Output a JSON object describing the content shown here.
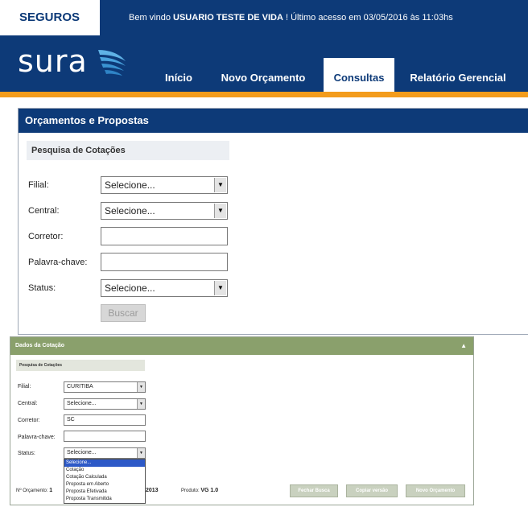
{
  "brand": {
    "seguros": "SEGUROS",
    "logo": "sura",
    "logo_icon": "sura-wings-icon",
    "primary_color": "#0d3a78",
    "accent_color": "#f39c1c"
  },
  "welcome": {
    "prefix": "Bem vindo ",
    "user": "USUARIO TESTE DE VIDA",
    "suffix": " ! Último acesso em 03/05/2016 às 11:03hs"
  },
  "nav": {
    "items": [
      {
        "label": "Início"
      },
      {
        "label": "Novo Orçamento"
      },
      {
        "label": "Consultas"
      },
      {
        "label": "Relatório Gerencial"
      }
    ],
    "active": "Consultas"
  },
  "panel": {
    "title": "Orçamentos e Propostas",
    "subtitle": "Pesquisa de Cotações",
    "fields": {
      "filial": {
        "label": "Filial:",
        "value": "Selecione..."
      },
      "central": {
        "label": "Central:",
        "value": "Selecione..."
      },
      "corretor": {
        "label": "Corretor:",
        "value": ""
      },
      "palavra": {
        "label": "Palavra-chave:",
        "value": ""
      },
      "status": {
        "label": "Status:",
        "value": "Selecione..."
      }
    },
    "search_button": "Buscar"
  },
  "detail": {
    "title": "Dados da Cotação",
    "subtitle": "Pesquisa de Cotações",
    "fields": {
      "filial": {
        "label": "Filial:",
        "value": "CURITIBA"
      },
      "central": {
        "label": "Central:",
        "value": "Selecione..."
      },
      "corretor": {
        "label": "Corretor:",
        "value": "SC"
      },
      "palavra": {
        "label": "Palavra-chave:",
        "value": ""
      },
      "status": {
        "label": "Status:",
        "value": "Selecione..."
      }
    },
    "status_options": [
      "Selecione...",
      "Cotação",
      "Cotação Calculada",
      "Proposta em Aberto",
      "Proposta Efetivada",
      "Proposta Transmitida"
    ],
    "selected_option": "Selecione...",
    "orcamento_label": "Nº Orçamento:",
    "orcamento_value_start": "1",
    "orcamento_value_end": "2013",
    "produto_label": "Produto:",
    "produto_value": "VG 1.0",
    "buttons": {
      "fechar": "Fechar Busca",
      "copiar": "Copiar versão",
      "novo": "Novo Orçamento"
    }
  }
}
